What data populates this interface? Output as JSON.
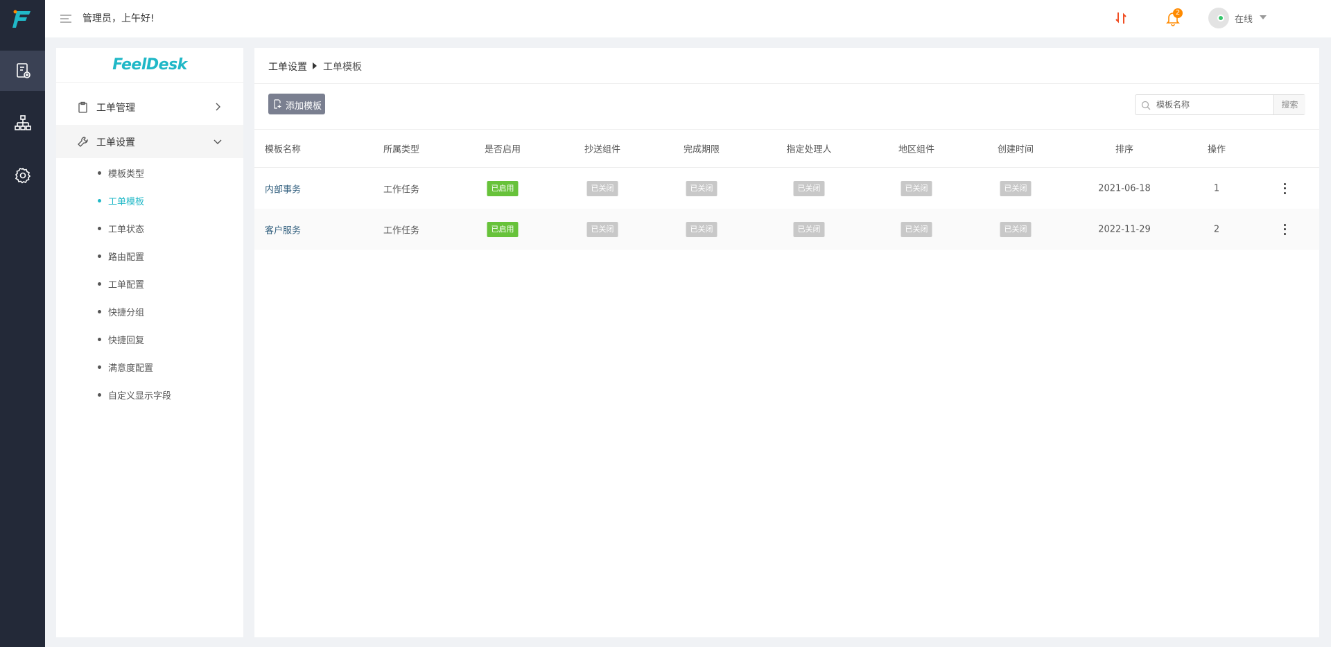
{
  "topbar": {
    "greeting": "管理员，上午好!",
    "notification_count": "2",
    "status": "在线"
  },
  "rail": {
    "items": [
      {
        "icon": "ticket-settings-icon",
        "active": true
      },
      {
        "icon": "org-chart-icon",
        "active": false
      },
      {
        "icon": "gear-icon",
        "active": false
      }
    ]
  },
  "sidemenu": {
    "brand": "FeelDesk",
    "groups": [
      {
        "label": "工单管理",
        "open": false
      },
      {
        "label": "工单设置",
        "open": true
      }
    ],
    "items": [
      {
        "label": "模板类型",
        "active": false
      },
      {
        "label": "工单模板",
        "active": true
      },
      {
        "label": "工单状态",
        "active": false
      },
      {
        "label": "路由配置",
        "active": false
      },
      {
        "label": "工单配置",
        "active": false
      },
      {
        "label": "快捷分组",
        "active": false
      },
      {
        "label": "快捷回复",
        "active": false
      },
      {
        "label": "满意度配置",
        "active": false
      },
      {
        "label": "自定义显示字段",
        "active": false
      }
    ]
  },
  "main": {
    "breadcrumb": {
      "parent": "工单设置",
      "current": "工单模板"
    },
    "add_button": "添加模板",
    "search": {
      "placeholder": "模板名称",
      "button": "搜索"
    },
    "table": {
      "columns": [
        "模板名称",
        "所属类型",
        "是否启用",
        "抄送组件",
        "完成期限",
        "指定处理人",
        "地区组件",
        "创建时间",
        "排序",
        "操作"
      ],
      "rows": [
        {
          "name": "内部事务",
          "type": "工作任务",
          "enabled": "已启用",
          "cc": "已关闭",
          "deadline": "已关闭",
          "assignee": "已关闭",
          "region": "已关闭",
          "created": "已关闭",
          "date": "2021-06-18",
          "order": "1"
        },
        {
          "name": "客户服务",
          "type": "工作任务",
          "enabled": "已启用",
          "cc": "已关闭",
          "deadline": "已关闭",
          "assignee": "已关闭",
          "region": "已关闭",
          "created": "已关闭",
          "date": "2022-11-29",
          "order": "2"
        }
      ]
    }
  },
  "colors": {
    "rail_bg": "#232938",
    "accent": "#20b8c7",
    "tag_on": "#67c23a",
    "tag_off": "#c8c8c8",
    "add_button_bg": "#7a7f90"
  }
}
